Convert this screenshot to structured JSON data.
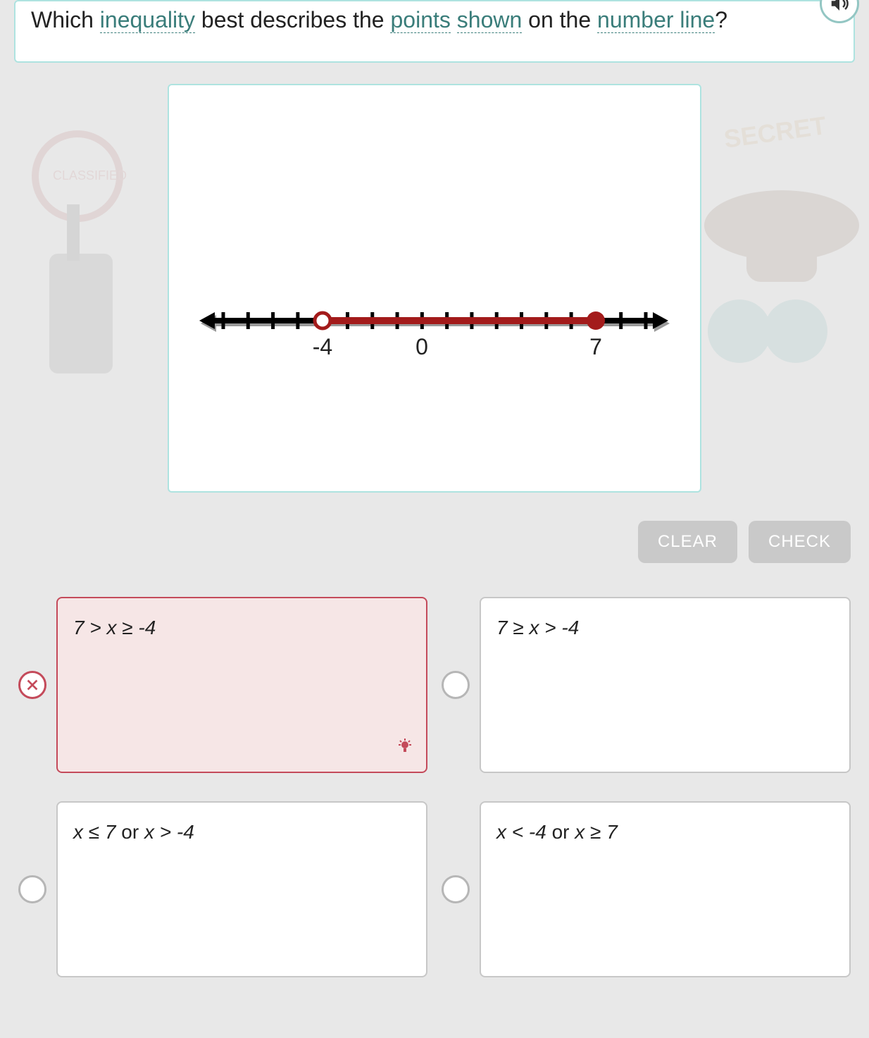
{
  "question": {
    "prefix": "Which ",
    "term1": "inequality",
    "mid1": " best describes the ",
    "term2": "points",
    "space1": " ",
    "term3": "shown",
    "mid2": " on the ",
    "term4": "number line",
    "suffix": "?"
  },
  "number_line": {
    "labels": [
      "-4",
      "0",
      "7"
    ],
    "open_at": -4,
    "closed_at": 7,
    "min_tick": -8,
    "max_tick": 9
  },
  "buttons": {
    "clear": "CLEAR",
    "check": "CHECK"
  },
  "options": {
    "a": {
      "text": "7 > x ≥ -4",
      "state": "incorrect"
    },
    "b": {
      "text": "7 ≥ x > -4",
      "state": "default"
    },
    "c": {
      "pre": "x ≤ 7 ",
      "or": "or",
      "post": " x > -4",
      "state": ""
    },
    "d": {
      "pre": "x < -4 ",
      "or": "or",
      "post": " x ≥ 7",
      "state": ""
    }
  }
}
